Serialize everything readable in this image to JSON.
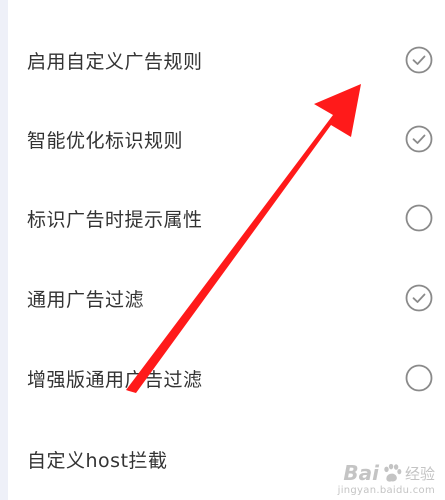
{
  "settings": {
    "items": [
      {
        "label": "启用自定义广告规则",
        "checked": true
      },
      {
        "label": "智能优化标识规则",
        "checked": true
      },
      {
        "label": "标识广告时提示属性",
        "checked": false
      },
      {
        "label": "通用广告过滤",
        "checked": true
      },
      {
        "label": "增强版通用广告过滤",
        "checked": false
      },
      {
        "label": "自定义host拦截"
      }
    ]
  },
  "colors": {
    "text": "#333333",
    "toggle_stroke": "#8a8a8a",
    "arrow": "#ff1a1a",
    "left_strip": "#eef0f8"
  },
  "watermark": {
    "brand": "Bai",
    "brand_cn": "经验",
    "url": "jingyan.baidu.com"
  }
}
